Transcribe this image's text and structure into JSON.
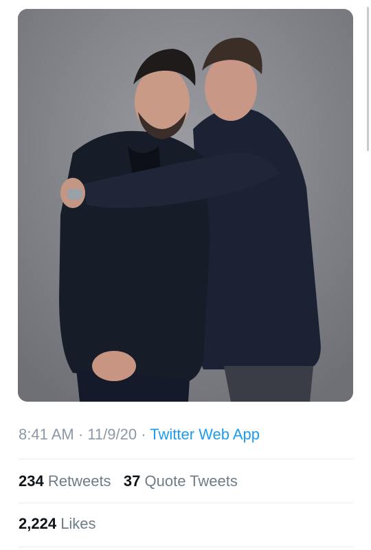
{
  "tweet": {
    "media": {
      "alt_icon": "photo-icon",
      "background_color": "#7d7e84"
    },
    "timestamp": {
      "time": "8:41 AM",
      "date": "11/9/20",
      "separator": "·",
      "source": "Twitter Web App"
    },
    "stats": {
      "retweets_count": "234",
      "retweets_label": "Retweets",
      "quote_count": "37",
      "quote_label": "Quote Tweets",
      "likes_count": "2,224",
      "likes_label": "Likes"
    },
    "colors": {
      "link": "#1d9bf0",
      "muted": "#8b98a5",
      "primary_text": "#0f1419",
      "divider": "#e7ecf0"
    }
  }
}
